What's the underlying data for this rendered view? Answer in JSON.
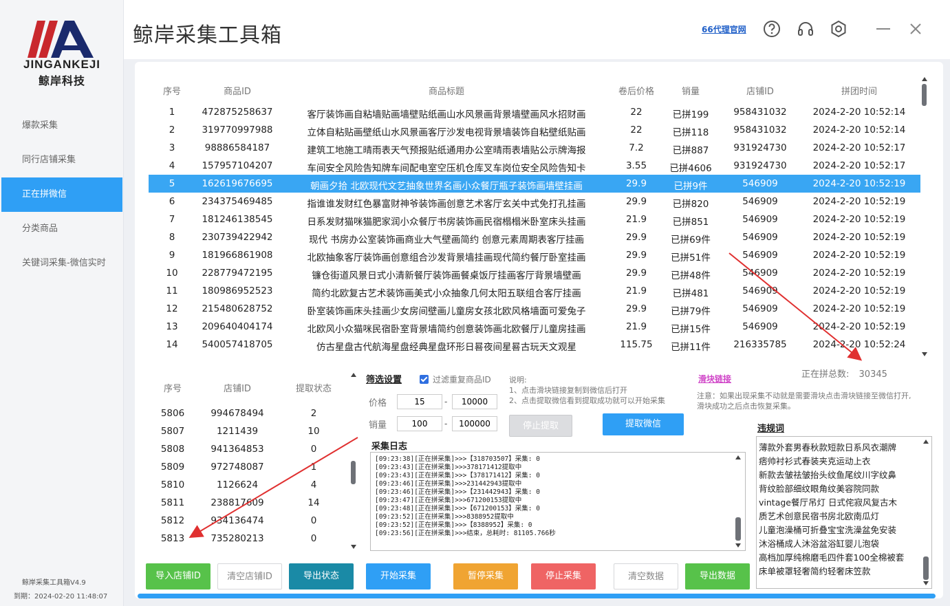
{
  "logo": {
    "en": "JINGANKEJI",
    "cn": "鲸岸科技"
  },
  "app": {
    "title": "鲸岸采集工具箱",
    "proxy_link": "66代理官网",
    "version": "鲸岸采集工具箱V4.9",
    "expire": "到期：2024-02-20 11:48:07"
  },
  "nav": {
    "items": [
      {
        "label": "爆款采集"
      },
      {
        "label": "同行店铺采集"
      },
      {
        "label": "正在拼微信"
      },
      {
        "label": "分类商品"
      },
      {
        "label": "关键词采集-微信实时"
      }
    ],
    "active": "正在拼微信"
  },
  "main_table": {
    "headers": [
      "序号",
      "商品ID",
      "商品标题",
      "卷后价格",
      "销量",
      "店铺ID",
      "拼团时间"
    ],
    "rows": [
      [
        "1",
        "472875258637",
        "客厅装饰画自粘墙贴画墙壁贴纸画山水风景画背景墙壁画风水招财画",
        "22",
        "已拼199",
        "958431032",
        "2024-2-20 10:52:14"
      ],
      [
        "2",
        "319770997988",
        "立体自粘贴画壁纸山水风景画客厅沙发电视背景墙装饰自粘壁纸贴画",
        "22",
        "已拼118",
        "958431032",
        "2024-2-20 10:52:14"
      ],
      [
        "3",
        "98886584187",
        "建筑工地施工晴雨表天气预报贴纸通用办公室晴雨表墙贴公示牌海报",
        "7.2",
        "已拼887",
        "931924730",
        "2024-2-20 10:52:17"
      ],
      [
        "4",
        "157957104207",
        "车间安全风险告知牌车间配电室空压机仓库叉车岗位安全风险告知卡",
        "3.55",
        "已拼4606",
        "931924730",
        "2024-2-20 10:52:17"
      ],
      [
        "5",
        "162619676695",
        "朝画夕拾 北欧现代文艺抽象世界名画小众餐厅瓶子装饰画墙壁挂画",
        "29.9",
        "已拼9件",
        "546909",
        "2024-2-20 10:52:19"
      ],
      [
        "6",
        "234375469485",
        "指谁谁发财红色暴富财神爷装饰画创意艺术客厅玄关中式免打孔挂画",
        "29.9",
        "已拼820",
        "546909",
        "2024-2-20 10:52:19"
      ],
      [
        "7",
        "181246138545",
        "日系发财猫咪猫肥家润小众餐厅书房装饰画民宿榻榻米卧室床头挂画",
        "21.9",
        "已拼851",
        "546909",
        "2024-2-20 10:52:19"
      ],
      [
        "8",
        "230739422942",
        "现代 书房办公室装饰画商业大气壁画简约 创意元素周期表客厅挂画",
        "29.9",
        "已拼69件",
        "546909",
        "2024-2-20 10:52:19"
      ],
      [
        "9",
        "181966861908",
        "北欧抽象客厅装饰画创意组合沙发背景墙挂画现代简约餐厅卧室挂画",
        "29.9",
        "已拼51件",
        "546909",
        "2024-2-20 10:52:19"
      ],
      [
        "10",
        "228779472195",
        "镰仓街道风景日式小清新餐厅装饰画餐桌饭厅挂画客厅背景墙壁画",
        "29.9",
        "已拼48件",
        "546909",
        "2024-2-20 10:52:19"
      ],
      [
        "11",
        "180986952523",
        "简约北欧复古艺术装饰画美式小众抽象几何太阳五联组合客厅挂画",
        "21.9",
        "已拼481",
        "546909",
        "2024-2-20 10:52:19"
      ],
      [
        "12",
        "215480628752",
        "卧室装饰画床头挂画少女房间壁画儿童房女孩北欧风格墙面可爱兔子",
        "29.9",
        "已拼79件",
        "546909",
        "2024-2-20 10:52:19"
      ],
      [
        "13",
        "209640404174",
        "北欧风小众猫咪民宿卧室背景墙简约创意装饰画北欧餐厅儿童房挂画",
        "21.9",
        "已拼15件",
        "546909",
        "2024-2-20 10:52:19"
      ],
      [
        "14",
        "540057418705",
        "仿古星盘古代航海星盘经典星盘环形日晷夜间星晷古玩天文观星",
        "115.75",
        "已拼11件",
        "216335785",
        "2024-2-20 10:52:24"
      ]
    ],
    "selected_row": 5
  },
  "total": {
    "label": "正在拼总数:",
    "value": "30345"
  },
  "shop_table": {
    "headers": [
      "序号",
      "店铺ID",
      "提取状态"
    ],
    "rows": [
      [
        "5806",
        "994678494",
        "2"
      ],
      [
        "5807",
        "1211439",
        "10"
      ],
      [
        "5808",
        "941364853",
        "0"
      ],
      [
        "5809",
        "972748087",
        "1"
      ],
      [
        "5810",
        "1126624",
        "4"
      ],
      [
        "5811",
        "238817609",
        "14"
      ],
      [
        "5812",
        "934136474",
        "0"
      ],
      [
        "5813",
        "735280213",
        "0"
      ]
    ]
  },
  "filter": {
    "title": "筛选设置",
    "dedupe_label": "过滤重复商品ID",
    "dedupe_checked": true,
    "price_label": "价格",
    "price_min": "15",
    "price_max": "10000",
    "sales_label": "销量",
    "sales_min": "100",
    "sales_max": "100000",
    "dash": "-"
  },
  "instructions": {
    "title": "说明:",
    "line1": "1、点击滑块链接复制到微信后打开",
    "line2": "2、点击提取微信看到提取成功就可以开始采集"
  },
  "slider": {
    "link": "滑块链接",
    "notice1": "注意：如果出现采集不动就是需要滑块点击滑块链接至微信打开,",
    "notice2": "滑块成功之后点击恢复采集。"
  },
  "buttons": {
    "stop_extract": "停止提取",
    "extract_wechat": "提取微信",
    "import_shop": "导入店铺ID",
    "clear_shop": "清空店铺ID",
    "export_state": "导出状态",
    "start": "开始采集",
    "pause": "暂停采集",
    "stop": "停止采集",
    "clear_data": "清空数据",
    "export_data": "导出数据"
  },
  "log": {
    "title": "采集日志",
    "lines": [
      "[09:23:38][正在拼采集]>>>【318703507】采集: 0",
      "[09:23:43][正在拼采集]>>>378171412提取中",
      "[09:23:43][正在拼采集]>>>【378171412】采集: 0",
      "[09:23:46][正在拼采集]>>>231442943提取中",
      "[09:23:46][正在拼采集]>>>【231442943】采集: 0",
      "[09:23:47][正在拼采集]>>>671200153提取中",
      "[09:23:48][正在拼采集]>>>【671200153】采集: 0",
      "[09:23:52][正在拼采集]>>>8388952提取中",
      "[09:23:52][正在拼采集]>>>【8388952】采集: 0",
      "[09:23:56][正在拼采集]>>>结束，总耗时: 81105.766秒"
    ]
  },
  "violation": {
    "title": "违规词",
    "lines": [
      "薄款外套男春秋款短款日系风衣潮牌",
      "痞帅衬衫式春装夹克运动上衣",
      "新款去皱祛皱抬头纹鱼尾纹川字纹鼻",
      "背纹脸部细纹眼角纹美容院同款",
      "vintage餐厅吊灯 日式侘寂风复古木",
      "质艺术创意民宿书房北欧南瓜灯",
      "儿童泡澡桶可折叠宝宝洗澡盆免安装",
      "沐浴桶成人沐浴盆浴缸婴儿泡袋",
      "高档加厚纯棉磨毛四件套100全棉被套",
      "床单被罩轻奢简约轻奢床笠款"
    ]
  },
  "colors": {
    "accent": "#2f9ff5",
    "green": "#57c24a",
    "teal": "#1a8aa6",
    "blue": "#2f9ff5",
    "orange": "#f0a432",
    "red": "#ef6464",
    "logo_red": "#c9282d",
    "logo_navy": "#1a2a6c"
  }
}
